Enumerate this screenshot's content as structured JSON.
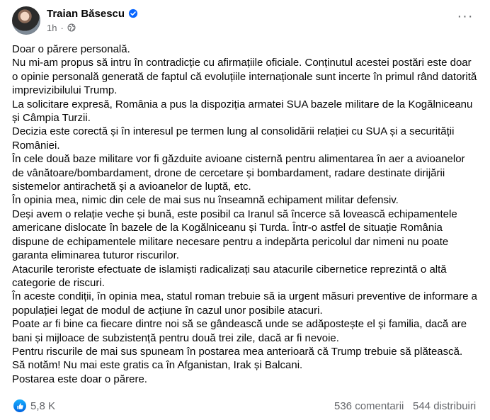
{
  "post": {
    "author": "Traian Băsescu",
    "time": "1h",
    "separator": "·",
    "more_label": "···",
    "paragraphs": [
      "Doar o părere personală.",
      "Nu mi-am propus să intru în contradicție cu afirmațiile oficiale. Conținutul acestei postări este doar o opinie personală generată de faptul că evoluțiile internaționale sunt incerte în primul rând datorită imprevizibilului Trump.",
      "La solicitare expresă, România a pus la dispoziția armatei SUA bazele militare de la Kogălniceanu și Câmpia Turzii.",
      "Decizia este corectă și în interesul pe termen lung al consolidării relației cu SUA și a securității României.",
      "În cele două baze militare vor fi găzduite  avioane cisternă pentru alimentarea în aer a avioanelor de vânătoare/bombardament, drone de cercetare și bombardament, radare destinate dirijării sistemelor antirachetă și a avioanelor de luptă, etc.",
      "În opinia mea, nimic din cele de mai sus nu înseamnă echipament militar defensiv.",
      "Deși avem o relație veche și bună, este posibil ca Iranul să încerce să lovească echipamentele americane dislocate în bazele de la Kogălniceanu și Turda. Într-o astfel de situație România dispune de echipamentele militare necesare pentru a indepărta pericolul dar nimeni nu poate garanta eliminarea tuturor riscurilor.",
      "Atacurile teroriste efectuate de islamiști radicalizați sau atacurile  cibernetice  reprezintă o altă categorie de riscuri.",
      "În aceste condiții, în opinia mea, statul roman trebuie să ia urgent măsuri preventive de informare a populației legat de modul de acțiune în cazul unor posibile atacuri.",
      "Poate ar fi bine ca fiecare dintre noi să se gândească  unde se adăpostește el și familia, dacă are bani și mijloace de subzistență pentru două trei zile, dacă ar fi nevoie.",
      "Pentru riscurile de mai sus spuneam în postarea mea anterioară că Trump trebuie să plătească.",
      "Să notăm!  Nu mai este gratis ca în Afganistan, Irak și Balcani.",
      "Postarea este doar o părere."
    ]
  },
  "footer": {
    "reactions": "5,8 K",
    "comments": "536 comentarii",
    "shares": "544 distribuiri"
  },
  "colors": {
    "verified_blue": "#0866ff",
    "secondary_text": "#65676b",
    "like_gradient_top": "#18afff",
    "like_gradient_bottom": "#0062df"
  },
  "icons": {
    "verified": "verified-badge-icon",
    "privacy": "globe-icon",
    "more": "more-options-icon",
    "reaction": "like-icon"
  }
}
